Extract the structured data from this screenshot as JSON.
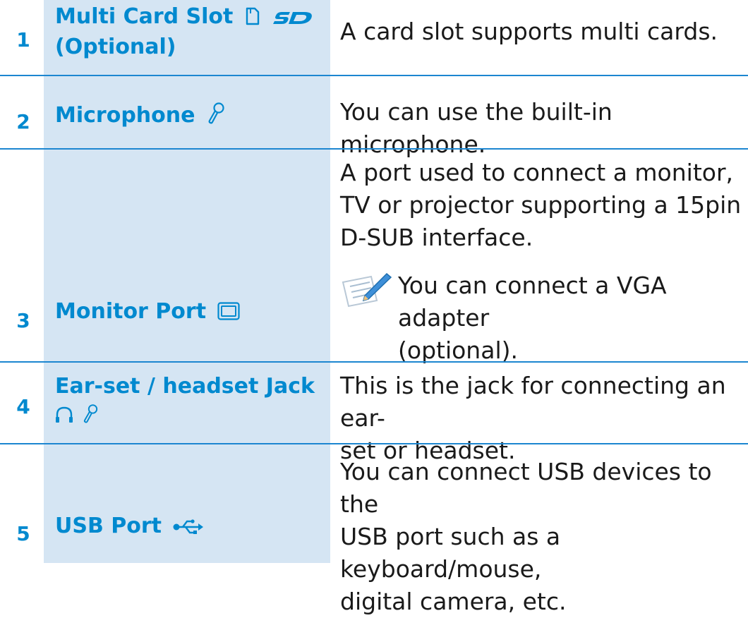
{
  "colors": {
    "accent": "#0089cf",
    "cell_bg": "#d5e5f3",
    "divider": "#1c86d0",
    "text": "#1a1a1a"
  },
  "rows": [
    {
      "number": "1",
      "name_line1": "Multi Card Slot",
      "name_line2": "(Optional)",
      "icons": [
        "sd-card-icon",
        "sd-logo-icon"
      ],
      "description": "A card slot supports multi cards."
    },
    {
      "number": "2",
      "name_line1": "Microphone",
      "icons": [
        "microphone-icon"
      ],
      "description": "You can use the built-in microphone."
    },
    {
      "number": "3",
      "name_line1": "Monitor Port",
      "icons": [
        "monitor-port-icon"
      ],
      "description_lines": [
        "A port used to connect a monitor,",
        "TV or projector supporting a 15pin",
        "D-SUB interface."
      ],
      "note_icon": "note-pencil-icon",
      "note_lines": [
        "You can connect a VGA adapter",
        "(optional)."
      ]
    },
    {
      "number": "4",
      "name_line1": "Ear-set / headset Jack",
      "icons": [
        "headphone-icon",
        "microphone-icon"
      ],
      "description_lines": [
        "This is the jack for connecting an ear-",
        "set or headset."
      ]
    },
    {
      "number": "5",
      "name_line1": "USB Port",
      "icons": [
        "usb-icon"
      ],
      "description_lines": [
        "You can connect USB devices to the",
        "USB port such as a keyboard/mouse,",
        "digital camera, etc."
      ]
    }
  ]
}
